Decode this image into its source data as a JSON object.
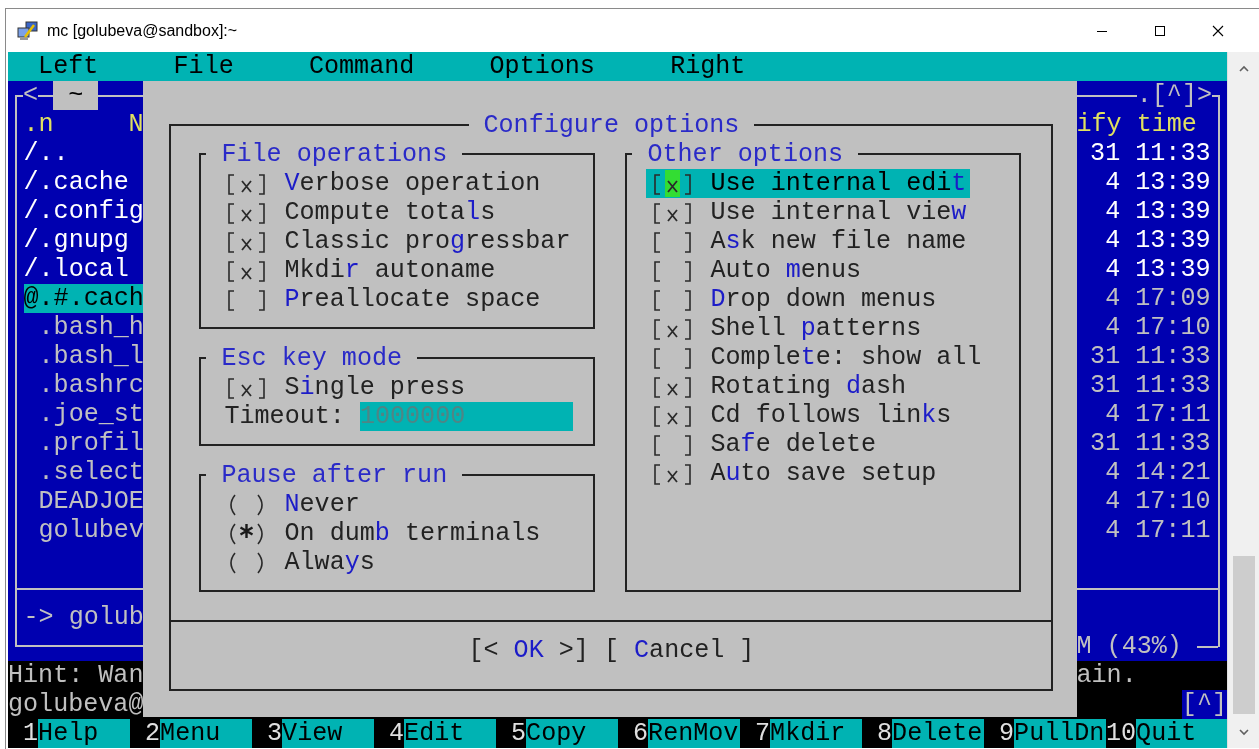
{
  "window": {
    "title": "mc [golubeva@sandbox]:~"
  },
  "menu_bar": [
    "Left",
    "File",
    "Command",
    "Options",
    "Right"
  ],
  "left_panel": {
    "nav": "<",
    "path": "~",
    "header": [
      ".n",
      "N"
    ],
    "rows": [
      {
        "name": "/..",
        "kind": "dir",
        "selected": false
      },
      {
        "name": "/.cache",
        "kind": "dir",
        "selected": false
      },
      {
        "name": "/.config",
        "kind": "dir",
        "selected": false
      },
      {
        "name": "/.gnupg",
        "kind": "dir",
        "selected": false
      },
      {
        "name": "/.local",
        "kind": "dir",
        "selected": false
      },
      {
        "name": "@.#.cach",
        "kind": "link",
        "selected": true
      },
      {
        "name": ".bash_h",
        "kind": "file",
        "selected": false
      },
      {
        "name": ".bash_l",
        "kind": "file",
        "selected": false
      },
      {
        "name": ".bashrc",
        "kind": "file",
        "selected": false
      },
      {
        "name": ".joe_st",
        "kind": "file",
        "selected": false
      },
      {
        "name": ".profil",
        "kind": "file",
        "selected": false
      },
      {
        "name": ".select",
        "kind": "file",
        "selected": false
      },
      {
        "name": "DEADJOE",
        "kind": "file",
        "selected": false
      },
      {
        "name": "golubev",
        "kind": "file",
        "selected": false
      }
    ],
    "mini_status": "-> golub"
  },
  "right_panel": {
    "nav": ".[^]>",
    "header": "ify time",
    "rows": [
      {
        "time": "31 11:33",
        "kind": "dir"
      },
      {
        "time": "4 13:39",
        "kind": "dir"
      },
      {
        "time": "4 13:39",
        "kind": "dir"
      },
      {
        "time": "4 13:39",
        "kind": "dir"
      },
      {
        "time": "4 13:39",
        "kind": "dir"
      },
      {
        "time": "4 17:09",
        "kind": "link"
      },
      {
        "time": "4 17:10",
        "kind": "file"
      },
      {
        "time": "31 11:33",
        "kind": "file"
      },
      {
        "time": "31 11:33",
        "kind": "file"
      },
      {
        "time": "4 17:11",
        "kind": "file"
      },
      {
        "time": "31 11:33",
        "kind": "file"
      },
      {
        "time": "4 14:21",
        "kind": "file"
      },
      {
        "time": "4 17:10",
        "kind": "file"
      },
      {
        "time": "4 17:11",
        "kind": "file"
      }
    ],
    "footer": "M (43%)"
  },
  "dialog": {
    "title": "Configure options",
    "columns": [
      [
        {
          "title": "File operations",
          "items": [
            {
              "kind": "checkbox",
              "label": "**V**erbose operation",
              "checked": true,
              "focused": false
            },
            {
              "kind": "checkbox",
              "label": "Compute tota**l**s",
              "checked": true,
              "focused": false
            },
            {
              "kind": "checkbox",
              "label": "Classic pro**g**ressbar",
              "checked": true,
              "focused": false
            },
            {
              "kind": "checkbox",
              "label": "Mkdi**r** autoname",
              "checked": true,
              "focused": false
            },
            {
              "kind": "checkbox",
              "label": "**P**reallocate space",
              "checked": false,
              "focused": false
            }
          ]
        },
        {
          "title": "Esc key mode",
          "items": [
            {
              "kind": "checkbox",
              "label": "S**i**ngle press",
              "checked": true,
              "focused": false
            },
            {
              "kind": "field",
              "label": "Timeout:",
              "value": "1000000"
            }
          ]
        },
        {
          "title": "Pause after run",
          "items": [
            {
              "kind": "radio",
              "label": "**N**ever",
              "selected": false,
              "focused": false
            },
            {
              "kind": "radio",
              "label": "On dum**b** terminals",
              "selected": true,
              "focused": false
            },
            {
              "kind": "radio",
              "label": "Alwa**y**s",
              "selected": false,
              "focused": false
            }
          ]
        }
      ],
      [
        {
          "title": "Other options",
          "items": [
            {
              "kind": "checkbox",
              "label": "Use internal edi**t**",
              "checked": true,
              "focused": true
            },
            {
              "kind": "checkbox",
              "label": "Use internal vie**w**",
              "checked": true,
              "focused": false
            },
            {
              "kind": "checkbox",
              "label": "A**s**k new file name",
              "checked": false,
              "focused": false
            },
            {
              "kind": "checkbox",
              "label": "Auto **m**enus",
              "checked": false,
              "focused": false
            },
            {
              "kind": "checkbox",
              "label": "**D**rop down menus",
              "checked": false,
              "focused": false
            },
            {
              "kind": "checkbox",
              "label": "Shell **p**atterns",
              "checked": true,
              "focused": false
            },
            {
              "kind": "checkbox",
              "label": "Comple**t**e: show all",
              "checked": false,
              "focused": false
            },
            {
              "kind": "checkbox",
              "label": "Rotating **d**ash",
              "checked": true,
              "focused": false
            },
            {
              "kind": "checkbox",
              "label": "Cd follows lin**k**s",
              "checked": true,
              "focused": false
            },
            {
              "kind": "checkbox",
              "label": "Sa**f**e delete",
              "checked": false,
              "focused": false
            },
            {
              "kind": "checkbox",
              "label": "A**u**to save setup",
              "checked": true,
              "focused": false
            }
          ]
        }
      ]
    ],
    "buttons": [
      "[< **OK** >]",
      "[ **C**ancel ]"
    ]
  },
  "hint": [
    "Hint: Wan",
    "ain."
  ],
  "command_line": {
    "prompt": "golubeva@",
    "history_button": "[^]"
  },
  "function_keys": [
    {
      "key": "1",
      "label": "Help"
    },
    {
      "key": "2",
      "label": "Menu"
    },
    {
      "key": "3",
      "label": "View"
    },
    {
      "key": "4",
      "label": "Edit"
    },
    {
      "key": "5",
      "label": "Copy"
    },
    {
      "key": "6",
      "label": "RenMov"
    },
    {
      "key": "7",
      "label": "Mkdir"
    },
    {
      "key": "8",
      "label": "Delete"
    },
    {
      "key": "9",
      "label": "PullDn"
    },
    {
      "key": "10",
      "label": "Quit"
    }
  ]
}
